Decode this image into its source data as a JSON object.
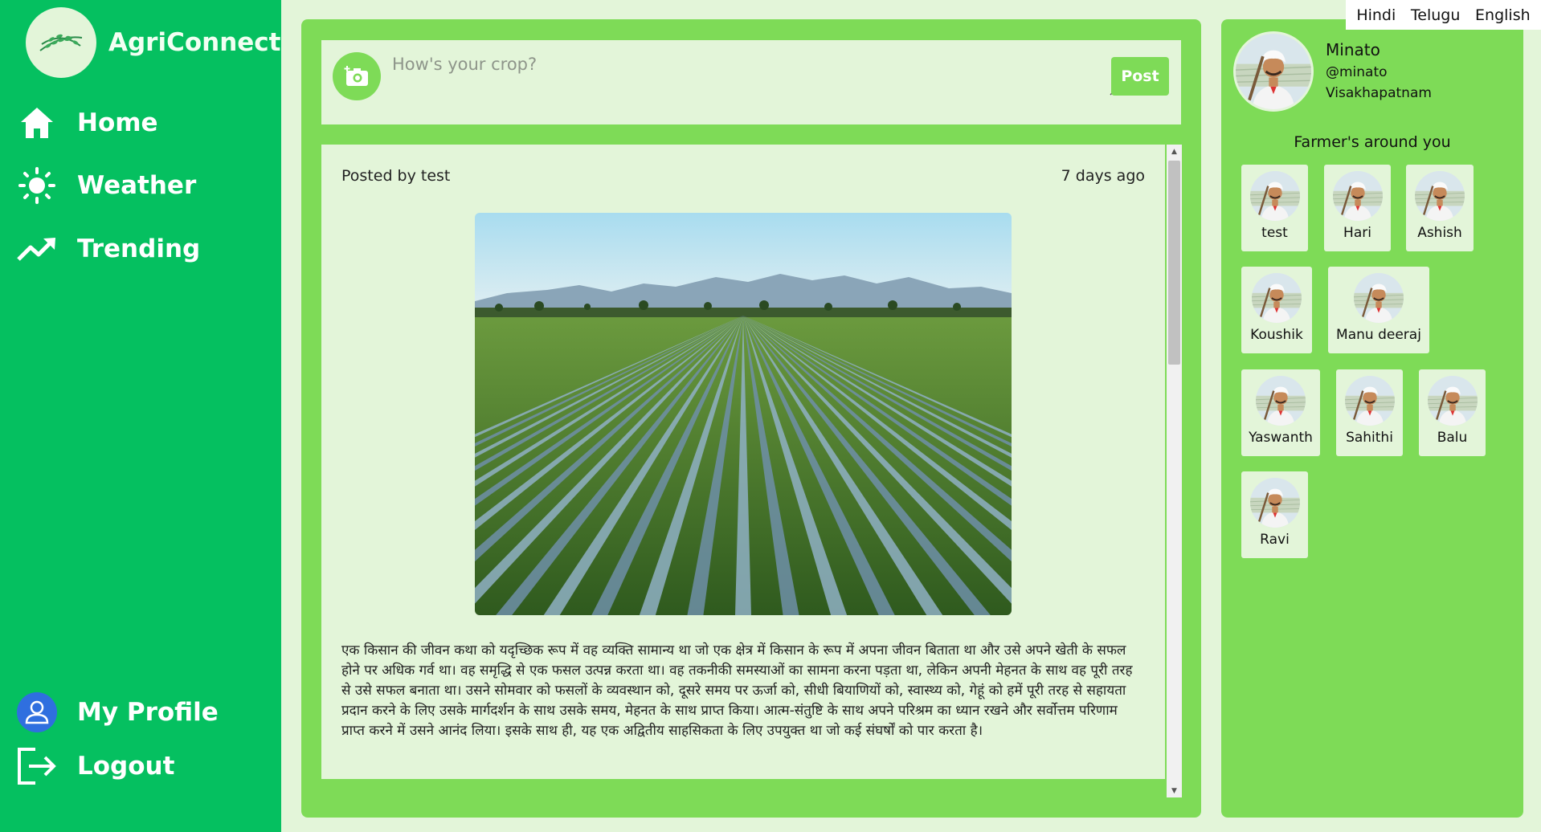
{
  "brand": {
    "name": "AgriConnect"
  },
  "nav": {
    "home": "Home",
    "weather": "Weather",
    "trending": "Trending",
    "profile": "My Profile",
    "logout": "Logout"
  },
  "composer": {
    "placeholder": "How's your crop?",
    "post_label": "Post"
  },
  "post": {
    "author": "Posted by test",
    "time": "7 days ago",
    "body": "एक किसान की जीवन कथा को यदृच्छिक रूप में वह व्यक्ति सामान्य था जो एक क्षेत्र में किसान के रूप में अपना जीवन बिताता था और उसे अपने खेती के सफल होने पर अधिक गर्व था। वह समृद्धि से एक फसल उत्पन्न करता था। वह तकनीकी समस्याओं का सामना करना पड़ता था, लेकिन अपनी मेहनत के साथ वह पूरी तरह से उसे सफल बनाता था। उसने सोमवार को फसलों के व्यवस्थान को, दूसरे समय पर ऊर्जा को, सीधी बियाणियों को, स्वास्थ्य को, गेहूं को हमें पूरी तरह से सहायता प्रदान करने के लिए उसके मार्गदर्शन के साथ उसके समय, मेहनत के साथ प्राप्त किया। आत्म-संतुष्टि के साथ अपने परिश्रम का ध्यान रखने और सर्वोत्तम परिणाम प्राप्त करने में उसने आनंद लिया। इसके साथ ही, यह एक अद्वितीय साहसिकता के लिए उपयुक्त था जो कई संघर्षों को पार करता है।"
  },
  "profile": {
    "name": "Minato",
    "handle": "@minato",
    "city": "Visakhapatnam"
  },
  "farmers": {
    "title": "Farmer's around you",
    "list": [
      "test",
      "Hari",
      "Ashish",
      "Koushik",
      "Manu deeraj",
      "Yaswanth",
      "Sahithi",
      "Balu",
      "Ravi"
    ]
  },
  "languages": [
    "Hindi",
    "Telugu",
    "English"
  ]
}
